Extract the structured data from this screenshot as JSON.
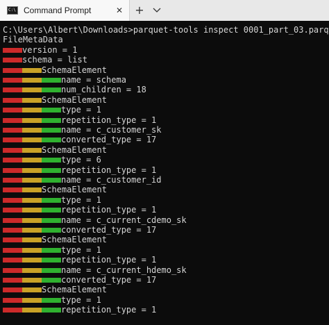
{
  "window": {
    "tab_title": "Command Prompt",
    "tab_close": "✕",
    "new_tab": "+",
    "icons": {
      "tab": "cmd-icon",
      "close": "close-icon",
      "new_tab": "plus-icon",
      "dropdown": "chevron-down-icon"
    }
  },
  "terminal": {
    "colors": {
      "red": "#cc2a2a",
      "yellow": "#c9a227",
      "green": "#2fb12f",
      "text": "#d6d6d6",
      "background": "#0c0c0c"
    },
    "lines": [
      {
        "depth": 0,
        "text": "C:\\Users\\Albert\\Downloads>parquet-tools inspect 0001_part_03.parquet"
      },
      {
        "depth": 0,
        "text": "FileMetaData"
      },
      {
        "depth": 1,
        "text": "version = 1"
      },
      {
        "depth": 1,
        "text": "schema = list"
      },
      {
        "depth": 2,
        "text": "SchemaElement"
      },
      {
        "depth": 3,
        "text": "name = schema"
      },
      {
        "depth": 3,
        "text": "num_children = 18"
      },
      {
        "depth": 2,
        "text": "SchemaElement"
      },
      {
        "depth": 3,
        "text": "type = 1"
      },
      {
        "depth": 3,
        "text": "repetition_type = 1"
      },
      {
        "depth": 3,
        "text": "name = c_customer_sk"
      },
      {
        "depth": 3,
        "text": "converted_type = 17"
      },
      {
        "depth": 2,
        "text": "SchemaElement"
      },
      {
        "depth": 3,
        "text": "type = 6"
      },
      {
        "depth": 3,
        "text": "repetition_type = 1"
      },
      {
        "depth": 3,
        "text": "name = c_customer_id"
      },
      {
        "depth": 2,
        "text": "SchemaElement"
      },
      {
        "depth": 3,
        "text": "type = 1"
      },
      {
        "depth": 3,
        "text": "repetition_type = 1"
      },
      {
        "depth": 3,
        "text": "name = c_current_cdemo_sk"
      },
      {
        "depth": 3,
        "text": "converted_type = 17"
      },
      {
        "depth": 2,
        "text": "SchemaElement"
      },
      {
        "depth": 3,
        "text": "type = 1"
      },
      {
        "depth": 3,
        "text": "repetition_type = 1"
      },
      {
        "depth": 3,
        "text": "name = c_current_hdemo_sk"
      },
      {
        "depth": 3,
        "text": "converted_type = 17"
      },
      {
        "depth": 2,
        "text": "SchemaElement"
      },
      {
        "depth": 3,
        "text": "type = 1"
      },
      {
        "depth": 3,
        "text": "repetition_type = 1"
      }
    ]
  }
}
